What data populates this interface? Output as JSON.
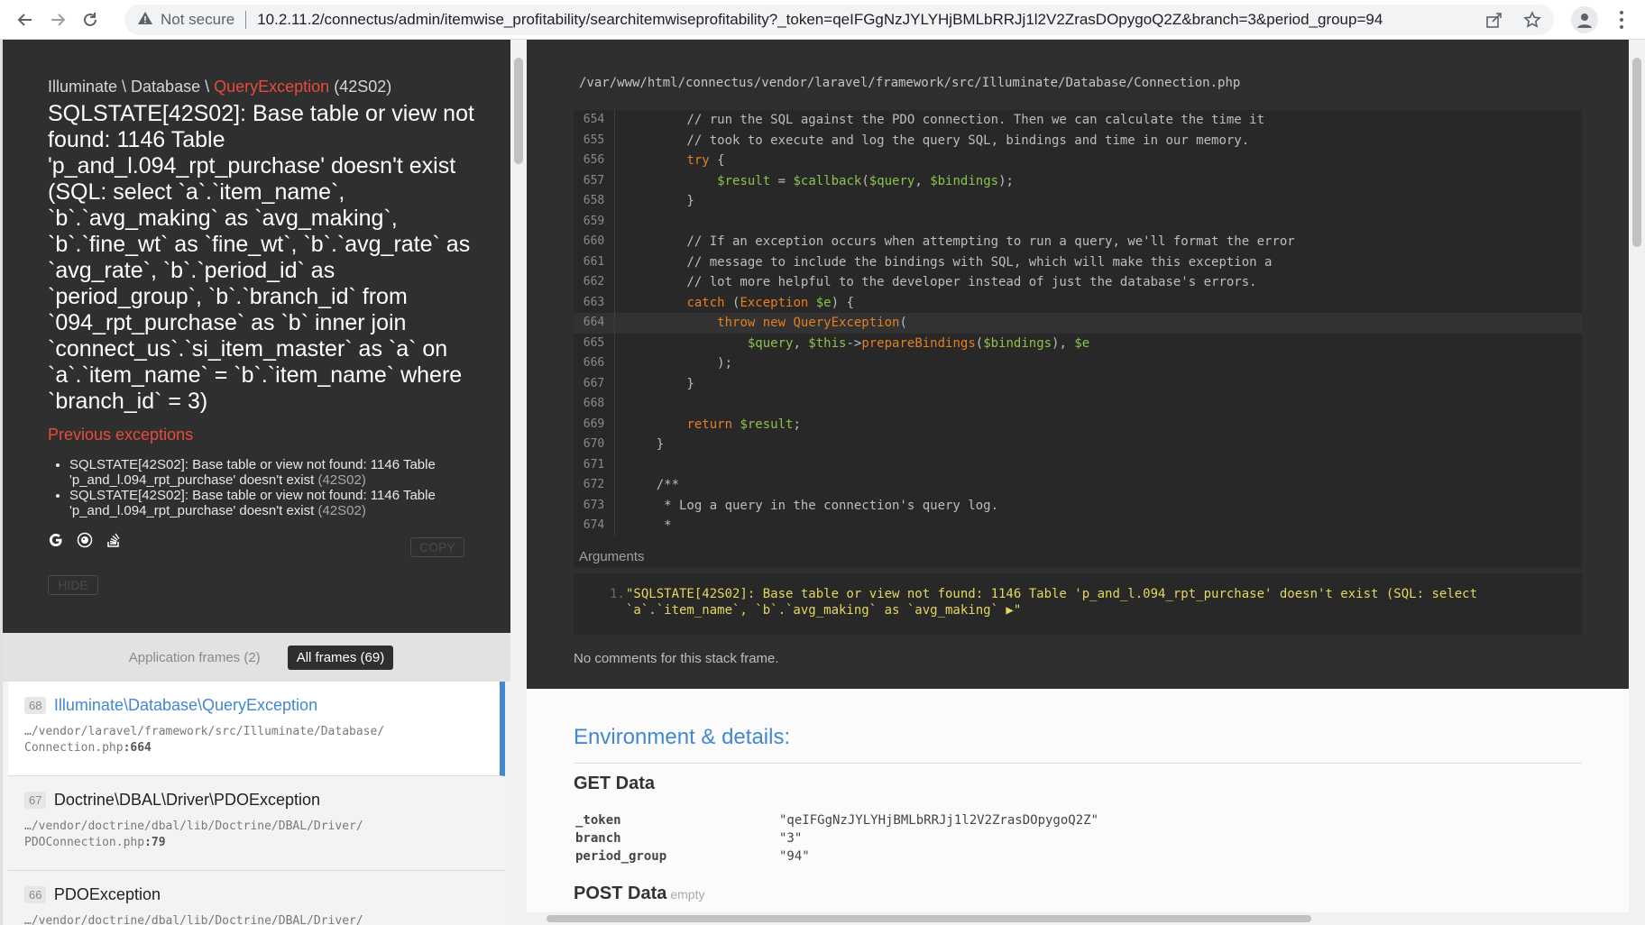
{
  "browser": {
    "security": "Not secure",
    "url": "10.2.11.2/connectus/admin/itemwise_profitability/searchitemwiseprofitability?_token=qeIFGgNzJYLYHjBMLbRRJj1l2V2ZrasDOpygoQ2Z&branch=3&period_group=94"
  },
  "exception": {
    "namespace": "Illuminate \\ Database \\",
    "type": "QueryException",
    "code": "(42S02)",
    "message": "SQLSTATE[42S02]: Base table or view not found: 1146 Table 'p_and_l.094_rpt_purchase' doesn't exist (SQL: select `a`.`item_name`, `b`.`avg_making` as `avg_making`, `b`.`fine_wt` as `fine_wt`, `b`.`avg_rate` as `avg_rate`, `b`.`period_id` as `period_group`, `b`.`branch_id` from `094_rpt_purchase` as `b` inner join `connect_us`.`si_item_master` as `a` on `a`.`item_name` = `b`.`item_name` where `branch_id` = 3)",
    "previous_title": "Previous exceptions",
    "previous": [
      {
        "text": "SQLSTATE[42S02]: Base table or view not found: 1146 Table 'p_and_l.094_rpt_purchase' doesn't exist",
        "code": "(42S02)"
      },
      {
        "text": "SQLSTATE[42S02]: Base table or view not found: 1146 Table 'p_and_l.094_rpt_purchase' doesn't exist",
        "code": "(42S02)"
      }
    ],
    "copy_label": "COPY",
    "hide_label": "HIDE",
    "icons": [
      "google-icon",
      "duckduckgo-icon",
      "stackoverflow-icon"
    ]
  },
  "frame_tabs": {
    "application": "Application frames (2)",
    "all": "All frames (69)"
  },
  "frames": [
    {
      "num": "68",
      "cls": "Illuminate\\Database\\QueryException",
      "file": "…/vendor/laravel/framework/src/Illuminate/Database/",
      "file2": "Connection.php",
      "line": ":664"
    },
    {
      "num": "67",
      "cls": "Doctrine\\DBAL\\Driver\\PDOException",
      "file": "…/vendor/doctrine/dbal/lib/Doctrine/DBAL/Driver/",
      "file2": "PDOConnection.php",
      "line": ":79"
    },
    {
      "num": "66",
      "cls": "PDOException",
      "file": "…/vendor/doctrine/dbal/lib/Doctrine/DBAL/Driver/",
      "file2": "",
      "line": ""
    }
  ],
  "code": {
    "path": "/var/www/html/connectus/vendor/laravel/framework/src/Illuminate/Database/Connection.php",
    "line_numbers": [
      "654",
      "655",
      "656",
      "657",
      "658",
      "659",
      "660",
      "661",
      "662",
      "663",
      "664",
      "665",
      "666",
      "667",
      "668",
      "669",
      "670",
      "671",
      "672",
      "673",
      "674"
    ],
    "args_title": "Arguments",
    "arg_index": "1.",
    "arg_value_1": "\"SQLSTATE[42S02]: Base table or view not found: 1146 Table 'p_and_l.094_rpt_purchase' doesn't exist (SQL: select",
    "arg_value_2": "`a`.`item_name`, `b`.`avg_making` as `avg_making` ▶\"",
    "no_comments": "No comments for this stack frame."
  },
  "env": {
    "title": "Environment & details:",
    "get_title": "GET Data",
    "get": [
      {
        "key": "_token",
        "value": "\"qeIFGgNzJYLYHjBMLbRRJj1l2V2ZrasDOpygoQ2Z\""
      },
      {
        "key": "branch",
        "value": "\"3\""
      },
      {
        "key": "period_group",
        "value": "\"94\""
      }
    ],
    "post_title": "POST Data",
    "post_empty": "empty"
  }
}
